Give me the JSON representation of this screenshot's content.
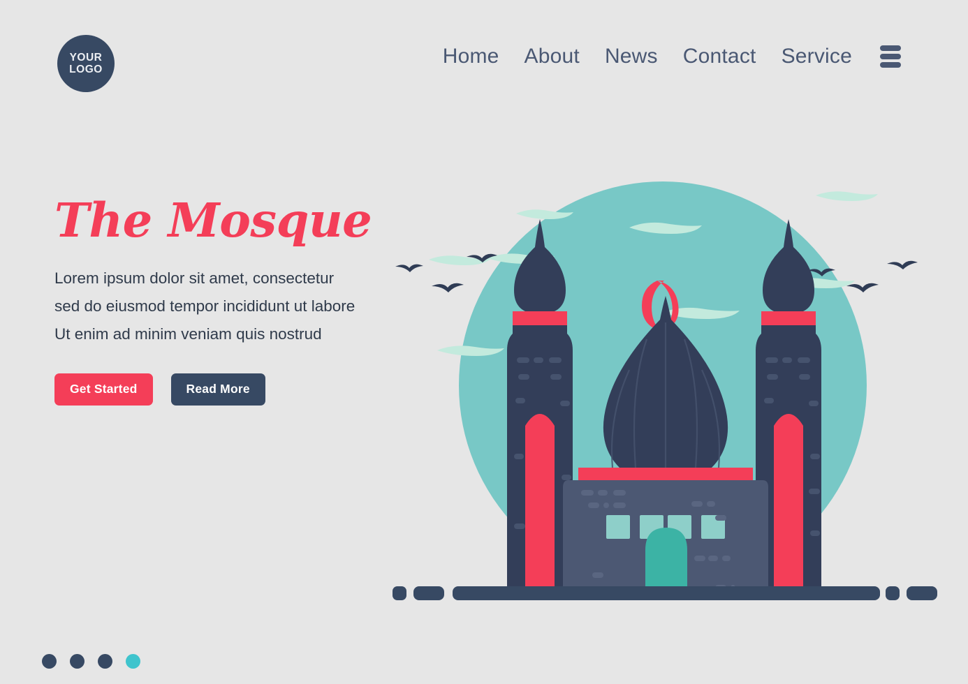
{
  "brand": {
    "logo_line1": "YOUR",
    "logo_line2": "LOGO"
  },
  "nav": {
    "items": [
      {
        "label": "Home"
      },
      {
        "label": "About"
      },
      {
        "label": "News"
      },
      {
        "label": "Contact"
      },
      {
        "label": "Service"
      }
    ],
    "menu_icon": "hamburger-menu-icon"
  },
  "hero": {
    "title": "The Mosque",
    "description_line1": "Lorem ipsum dolor sit amet, consectetur",
    "description_line2": "sed do eiusmod tempor incididunt ut labore",
    "description_line3": "Ut enim ad minim veniam quis nostrud",
    "primary_button": "Get Started",
    "secondary_button": "Read More"
  },
  "pagination": {
    "total": 4,
    "active_index": 4,
    "dots": [
      {
        "state": "inactive"
      },
      {
        "state": "inactive"
      },
      {
        "state": "inactive"
      },
      {
        "state": "active"
      }
    ]
  },
  "illustration": {
    "name": "mosque-illustration",
    "elements": [
      "sky-circle",
      "crescent-moon",
      "center-dome",
      "left-minaret-dome",
      "right-minaret-dome",
      "mosque-building",
      "arched-door",
      "windows",
      "clouds",
      "birds",
      "ground-line"
    ],
    "window_count": 4,
    "bird_count": 6,
    "cloud_count": 7
  },
  "colors": {
    "background": "#e6e6e6",
    "accent_red": "#f43e58",
    "navy": "#374963",
    "navy_dark": "#333e59",
    "building_body": "#4c5873",
    "teal_sky": "#78c8c6",
    "teal_door": "#3cb3a5",
    "teal_window": "#8ecfc9",
    "cloud": "#c3eadd",
    "dot_active": "#3fc4cd",
    "text": "#2f3a4a",
    "nav_text": "#4a5873"
  }
}
